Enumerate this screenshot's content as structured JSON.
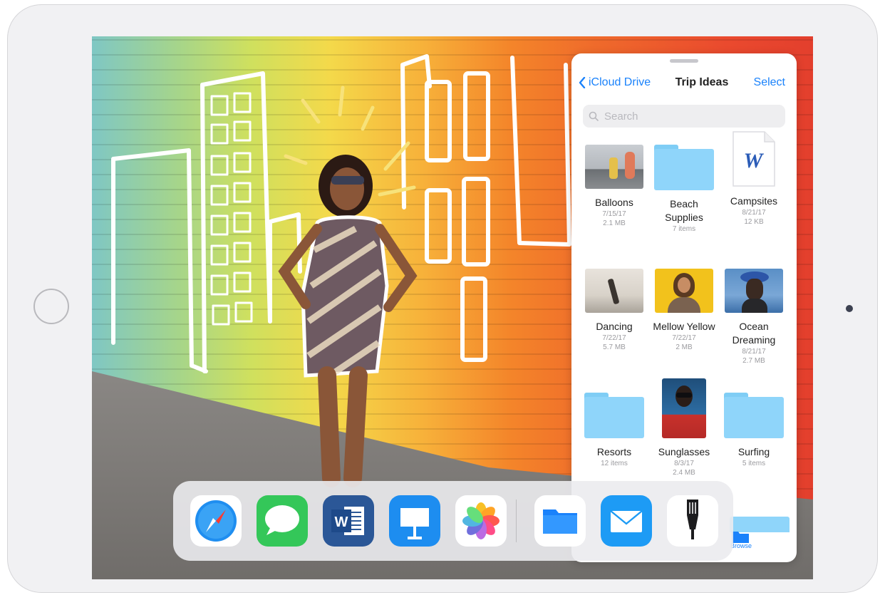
{
  "files_panel": {
    "back_label": "iCloud Drive",
    "title": "Trip Ideas",
    "select_label": "Select",
    "search_placeholder": "Search",
    "items": [
      {
        "name": "Balloons",
        "meta1": "7/15/17",
        "meta2": "2.1 MB",
        "kind": "photo"
      },
      {
        "name": "Beach Supplies",
        "meta1": "7 items",
        "meta2": "",
        "kind": "folder"
      },
      {
        "name": "Campsites",
        "meta1": "8/21/17",
        "meta2": "12 KB",
        "kind": "word-document"
      },
      {
        "name": "Dancing",
        "meta1": "7/22/17",
        "meta2": "5.7 MB",
        "kind": "photo"
      },
      {
        "name": "Mellow Yellow",
        "meta1": "7/22/17",
        "meta2": "2 MB",
        "kind": "photo"
      },
      {
        "name": "Ocean Dreaming",
        "meta1": "8/21/17",
        "meta2": "2.7 MB",
        "kind": "photo"
      },
      {
        "name": "Resorts",
        "meta1": "12 items",
        "meta2": "",
        "kind": "folder"
      },
      {
        "name": "Sunglasses",
        "meta1": "8/3/17",
        "meta2": "2.4 MB",
        "kind": "photo"
      },
      {
        "name": "Surfing",
        "meta1": "5 items",
        "meta2": "",
        "kind": "folder"
      }
    ],
    "tab_browse": "Browse",
    "colors": {
      "accent": "#1a82fb",
      "folder": "#8fd5fa"
    }
  },
  "dock": {
    "apps": [
      {
        "icon": "safari-icon"
      },
      {
        "icon": "messages-icon"
      },
      {
        "icon": "word-icon"
      },
      {
        "icon": "keynote-icon"
      },
      {
        "icon": "photos-icon"
      },
      {
        "icon": "files-icon"
      },
      {
        "icon": "mail-icon"
      },
      {
        "icon": "pen-app-icon"
      }
    ]
  },
  "icons": {
    "word_glyph": "W"
  }
}
